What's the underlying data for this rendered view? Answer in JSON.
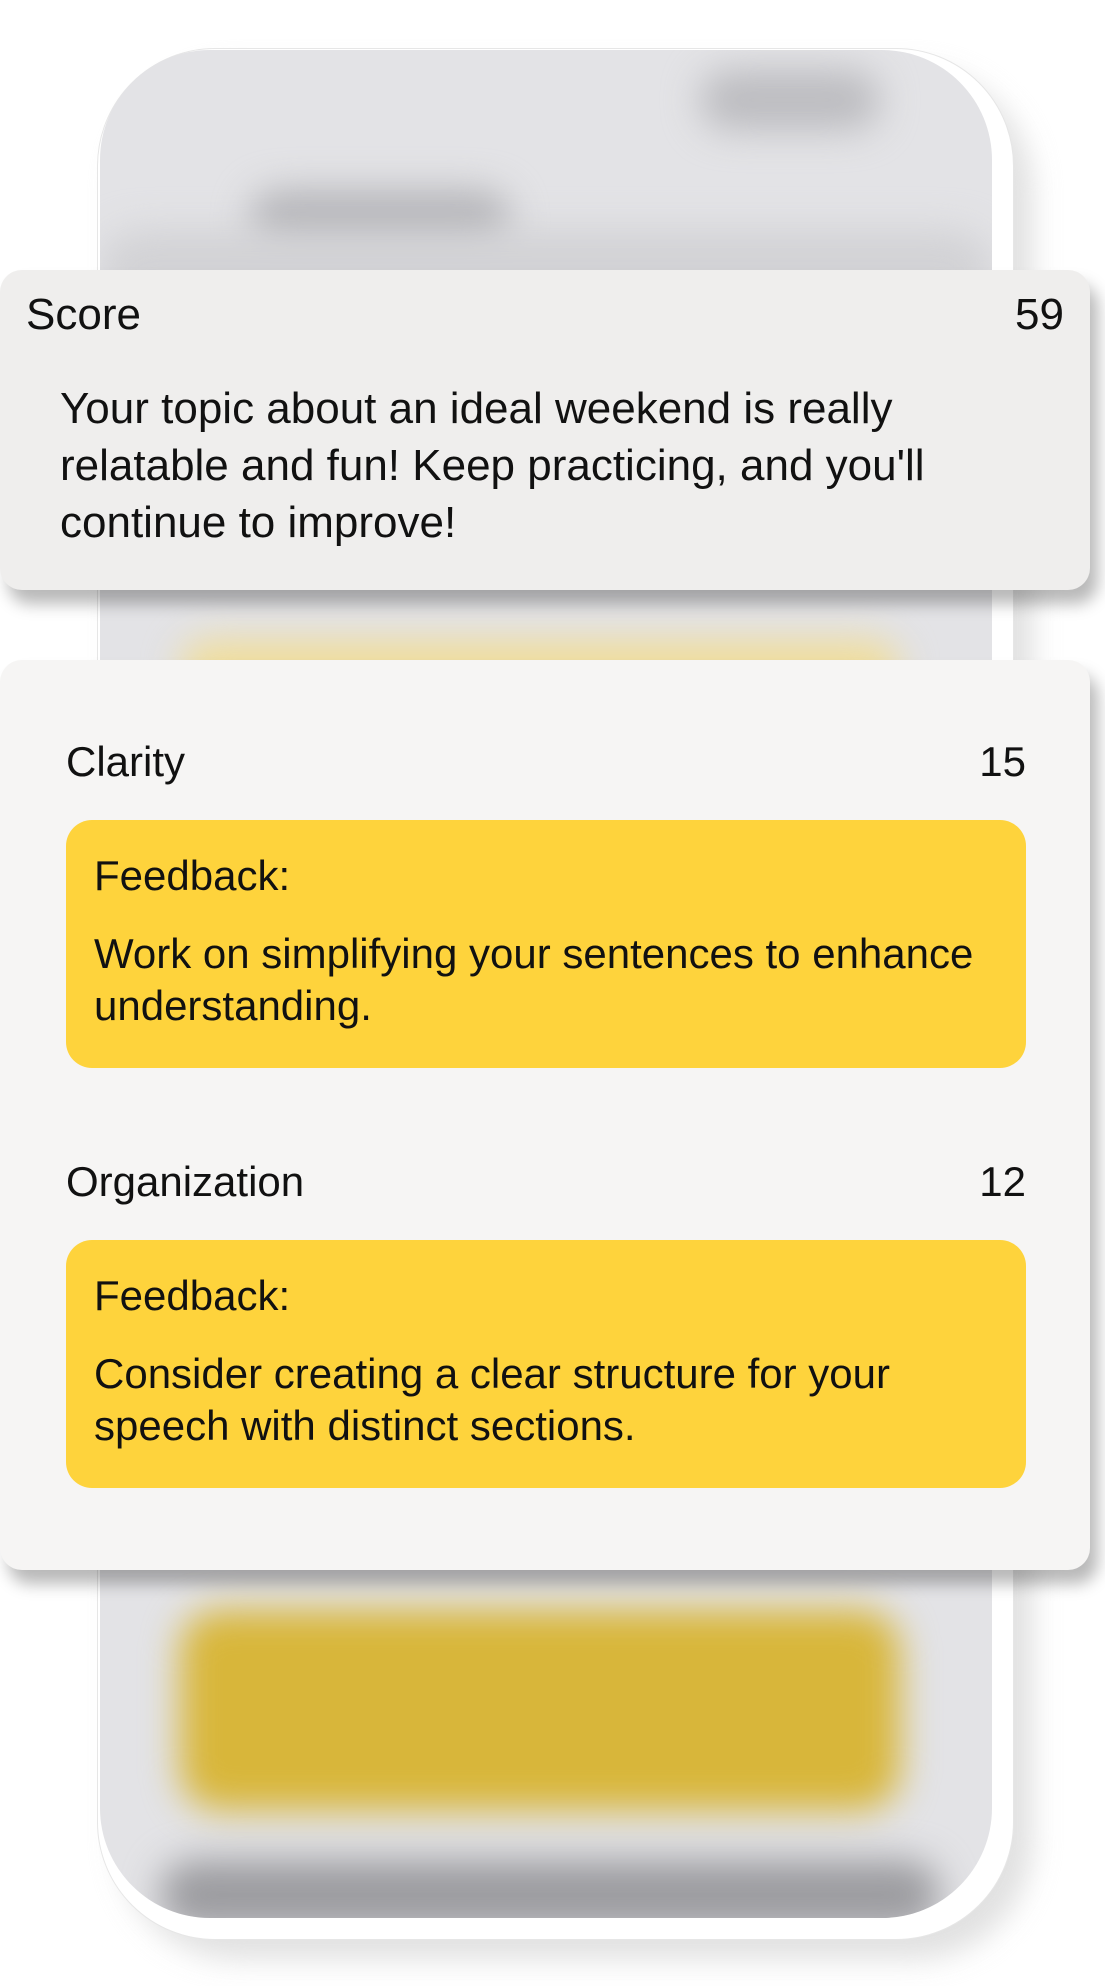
{
  "score_card": {
    "label": "Score",
    "value": "59",
    "message": "Your topic about an ideal weekend is really relatable and fun! Keep practicing, and you'll continue to improve!"
  },
  "criteria": [
    {
      "name": "Clarity",
      "score": "15",
      "feedback_label": "Feedback:",
      "feedback_text": "Work on simplifying your sentences to enhance understanding."
    },
    {
      "name": "Organization",
      "score": "12",
      "feedback_label": "Feedback:",
      "feedback_text": "Consider creating a clear structure for your speech with distinct sections."
    }
  ],
  "colors": {
    "feedback_background": "#fed33c",
    "score_card_background": "#efeeed",
    "details_card_background": "#f6f5f4",
    "phone_screen_background": "#e3e3e6"
  }
}
